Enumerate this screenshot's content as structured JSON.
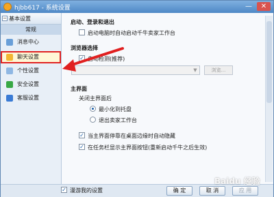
{
  "window": {
    "title": "hjbb617 - 系统设置",
    "minimize": "—",
    "close": "✕"
  },
  "sidebar": {
    "header": "基本设置",
    "sub": "常规",
    "items": [
      {
        "label": "消息中心",
        "icon": "mail-icon",
        "color": "#6a9fd8"
      },
      {
        "label": "聊天设置",
        "icon": "chat-icon",
        "color": "#f2b632"
      },
      {
        "label": "个性设置",
        "icon": "personal-icon",
        "color": "#8fb7e3"
      },
      {
        "label": "安全设置",
        "icon": "shield-icon",
        "color": "#38a845"
      },
      {
        "label": "客服设置",
        "icon": "service-icon",
        "color": "#3a7bd5"
      }
    ]
  },
  "content": {
    "startup": {
      "title": "启动、登录和退出",
      "autostart_label": "启动电脑时自动启动千牛卖家工作台"
    },
    "browser": {
      "title": "浏览器选择",
      "auto_detect_label": "自动检测(推荐)",
      "browse_label": "浏览..."
    },
    "main_ui": {
      "title": "主界面",
      "close_label": "关闭主界面后",
      "minimize_label": "最小化到托盘",
      "exit_label": "退出卖家工作台",
      "autohide_label": "当主界面停靠在桌面边缘时自动隐藏",
      "taskbar_label": "在任务栏显示主界面按钮(重新启动千牛之后生效)"
    }
  },
  "footer": {
    "roam_label": "漫游我的设置",
    "ok": "确 定",
    "cancel": "取 消",
    "apply": "应 用"
  },
  "watermark": "Baidu 经验",
  "colors": {
    "annotation_red": "#e02020"
  }
}
